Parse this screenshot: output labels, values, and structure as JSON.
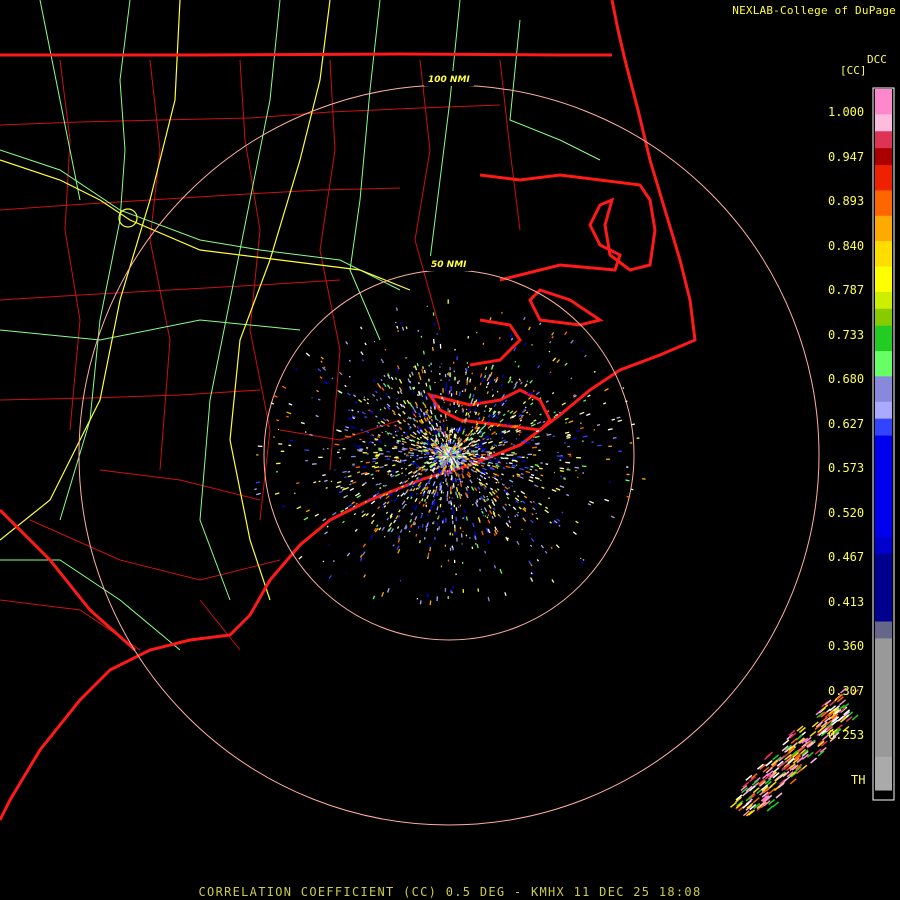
{
  "credit": "NEXLAB-College of DuPage",
  "legend": {
    "product": "DCC",
    "unit": "[CC]",
    "labels": [
      "1.000",
      "0.947",
      "0.893",
      "0.840",
      "0.787",
      "0.733",
      "0.680",
      "0.627",
      "0.573",
      "0.520",
      "0.467",
      "0.413",
      "0.360",
      "0.307",
      "0.253",
      "TH"
    ],
    "colors": [
      "#ff88cc",
      "#ffbbdd",
      "#dd3355",
      "#aa0000",
      "#ee2200",
      "#ff6600",
      "#ffaa00",
      "#ffdd00",
      "#ffff00",
      "#ccee00",
      "#88cc00",
      "#22cc22",
      "#66ff66",
      "#8888dd",
      "#aaaaff",
      "#3344ff",
      "#0000ee",
      "#0000cc",
      "#00008f",
      "#666688",
      "#999999",
      "#aaaaaa",
      "#000000"
    ]
  },
  "range_rings": [
    "100 NMI",
    "50 NMI"
  ],
  "colors": {
    "state_border": "#ff1a1a",
    "county": "#cc1111",
    "highway_major": "#ffff33",
    "highway": "#88ff88",
    "range_ring": "#ffb0a0"
  },
  "footer": "CORRELATION COEFFICIENT (CC) 0.5 DEG - KMHX 11 DEC 25 18:08"
}
